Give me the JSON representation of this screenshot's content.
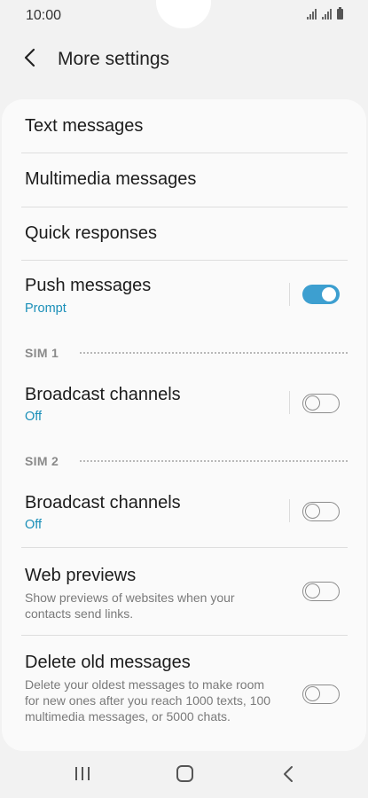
{
  "status": {
    "time": "10:00"
  },
  "header": {
    "title": "More settings"
  },
  "rows": {
    "text_messages": {
      "title": "Text messages"
    },
    "multimedia_messages": {
      "title": "Multimedia messages"
    },
    "quick_responses": {
      "title": "Quick responses"
    },
    "push_messages": {
      "title": "Push messages",
      "subtitle": "Prompt",
      "enabled": true
    },
    "broadcast_sim1": {
      "title": "Broadcast channels",
      "subtitle": "Off",
      "enabled": false
    },
    "broadcast_sim2": {
      "title": "Broadcast channels",
      "subtitle": "Off",
      "enabled": false
    },
    "web_previews": {
      "title": "Web previews",
      "description": "Show previews of websites when your contacts send links.",
      "enabled": false
    },
    "delete_old": {
      "title": "Delete old messages",
      "description": "Delete your oldest messages to make room for new ones after you reach 1000 texts, 100 multimedia messages, or 5000 chats.",
      "enabled": false
    }
  },
  "sections": {
    "sim1": "SIM 1",
    "sim2": "SIM 2"
  },
  "colors": {
    "accent": "#3d9fd0",
    "subtitle": "#1a8fb8",
    "background": "#f2f2f2",
    "card": "#fafafa"
  }
}
